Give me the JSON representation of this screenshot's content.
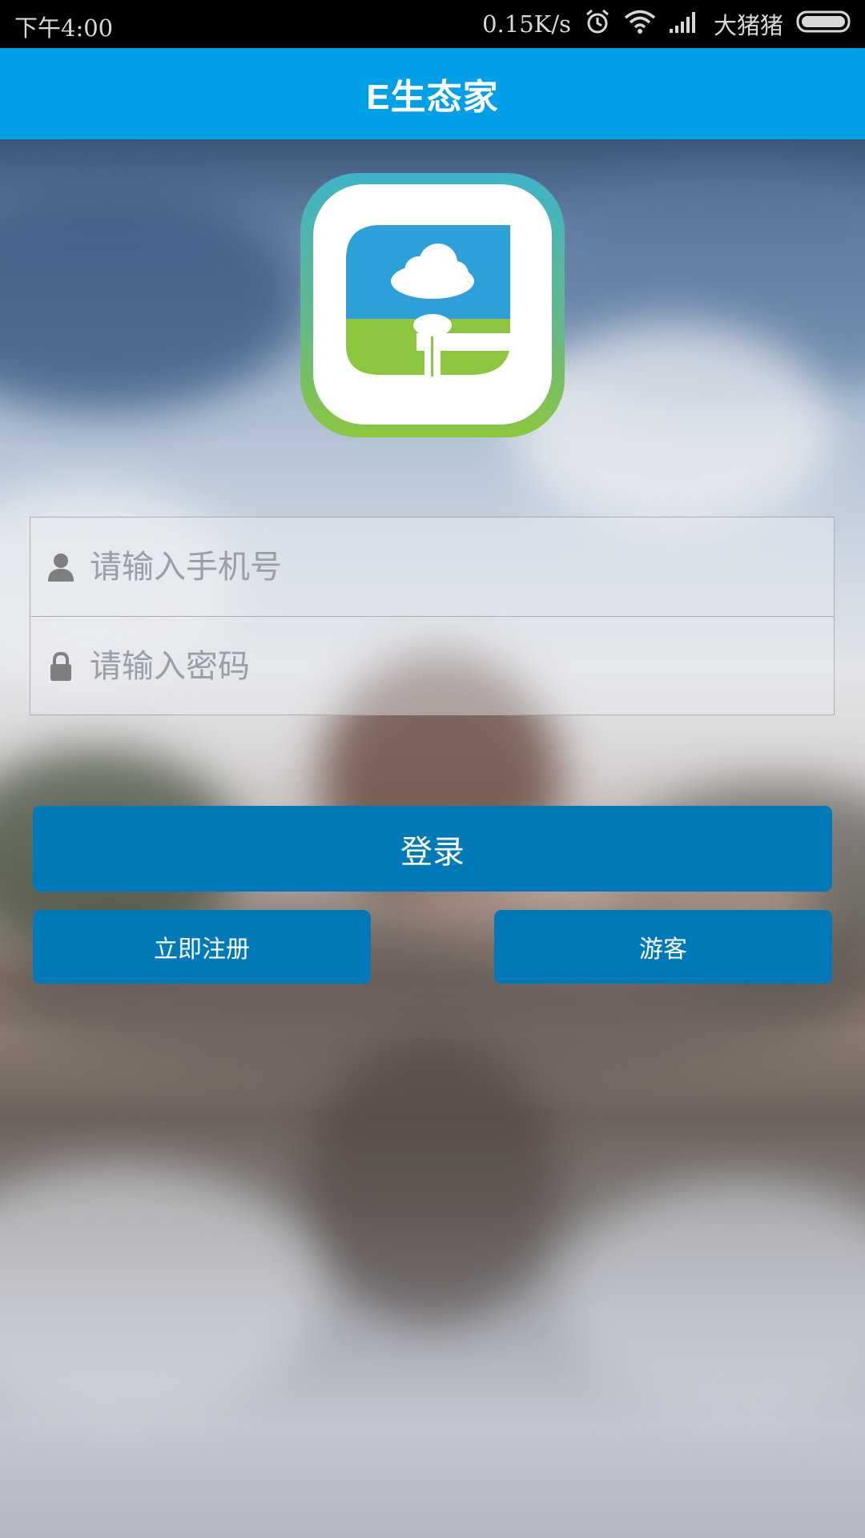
{
  "status_bar": {
    "time": "下午4:00",
    "net_speed": "0.15K/s",
    "carrier": "大猪猪",
    "icons": [
      "alarm-icon",
      "wifi-icon",
      "signal-icon",
      "battery-icon"
    ]
  },
  "app_bar": {
    "title": "E生态家"
  },
  "logo": {
    "icon": "app-logo-icon",
    "colors": {
      "blue": "#2d9fd9",
      "green": "#8cc63f",
      "frame_teal": "#3fb3c9"
    }
  },
  "login_form": {
    "phone": {
      "placeholder": "请输入手机号",
      "icon": "user-icon",
      "value": ""
    },
    "password": {
      "placeholder": "请输入密码",
      "icon": "lock-icon",
      "value": ""
    }
  },
  "actions": {
    "login_label": "登录",
    "register_label": "立即注册",
    "guest_label": "游客"
  },
  "theme": {
    "app_bar_color": "#00a0e8",
    "button_color": "#0079b8"
  }
}
